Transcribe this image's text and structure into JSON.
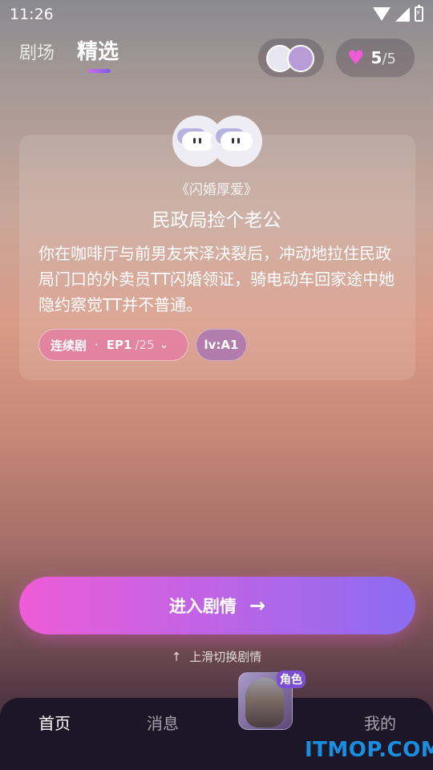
{
  "status_bar": {
    "time": "11:26"
  },
  "header": {
    "tabs": [
      "剧场",
      "精选"
    ],
    "active_tab": "精选",
    "hearts": {
      "count": "5",
      "total": "/5"
    }
  },
  "card": {
    "subtitle": "《闪婚厚爱》",
    "title": "民政局捡个老公",
    "description": "你在咖啡厅与前男友宋泽决裂后，冲动地拉住民政局门口的外卖员TT闪婚领证，骑电动车回家途中她隐约察觉TT并不普通。",
    "series_label": "连续剧",
    "episode": "EP1",
    "episode_total": "/25",
    "level": "lv:A1"
  },
  "cta": {
    "label": "进入剧情",
    "arrow": "→"
  },
  "swipe_hint": {
    "arrow": "↑",
    "label": "上滑切换剧情"
  },
  "bottom_nav": {
    "items": [
      "首页",
      "消息",
      "我的"
    ],
    "active": "首页",
    "role_badge": "角色"
  },
  "watermark": "ITMOP.COM",
  "colors": {
    "accent_pink": "#ee5cd8",
    "accent_purple": "#8b6cf2",
    "nav_bg": "#1d1528"
  },
  "icons": [
    "wifi-icon",
    "signal-icon",
    "battery-icon",
    "heart-icon",
    "chevron-down-icon",
    "arrow-right-icon",
    "arrow-up-icon"
  ]
}
